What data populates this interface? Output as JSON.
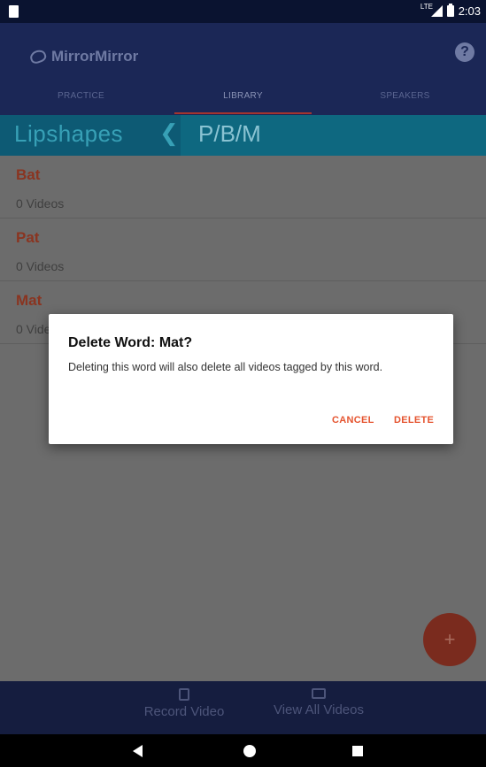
{
  "status_bar": {
    "network": "LTE",
    "time": "2:03"
  },
  "app": {
    "title": "MirrorMirror",
    "help_icon": "?"
  },
  "tabs": [
    {
      "label": "PRACTICE"
    },
    {
      "label": "LIBRARY"
    },
    {
      "label": "SPEAKERS"
    }
  ],
  "breadcrumb": {
    "parent": "Lipshapes",
    "separator": "❮",
    "current": "P/B/M"
  },
  "words": [
    {
      "word": "Bat",
      "count": "0 Videos"
    },
    {
      "word": "Pat",
      "count": "0 Videos"
    },
    {
      "word": "Mat",
      "count": "0 Videos"
    }
  ],
  "fab_label": "+",
  "bottom_bar": {
    "record_label": "Record Video",
    "view_all_label": "View All Videos"
  },
  "dialog": {
    "title": "Delete Word: Mat?",
    "message": "Deleting this word will also delete all videos tagged by this word.",
    "cancel_label": "CANCEL",
    "delete_label": "DELETE"
  },
  "colors": {
    "app_bar": "#1b2756",
    "accent": "#e5542f",
    "breadcrumb": "#0e6880",
    "dim_overlay": "#6c6c6c"
  },
  "icons": {
    "status_left": "sd-card-icon",
    "signal": "signal-icon",
    "battery": "battery-icon",
    "logo": "mirror-logo-icon",
    "help": "help-icon",
    "back": "back-chevron-icon",
    "record": "camera-icon",
    "view_all": "video-list-icon",
    "nav_back": "nav-back-icon",
    "nav_home": "nav-home-icon",
    "nav_recent": "nav-recents-icon"
  }
}
